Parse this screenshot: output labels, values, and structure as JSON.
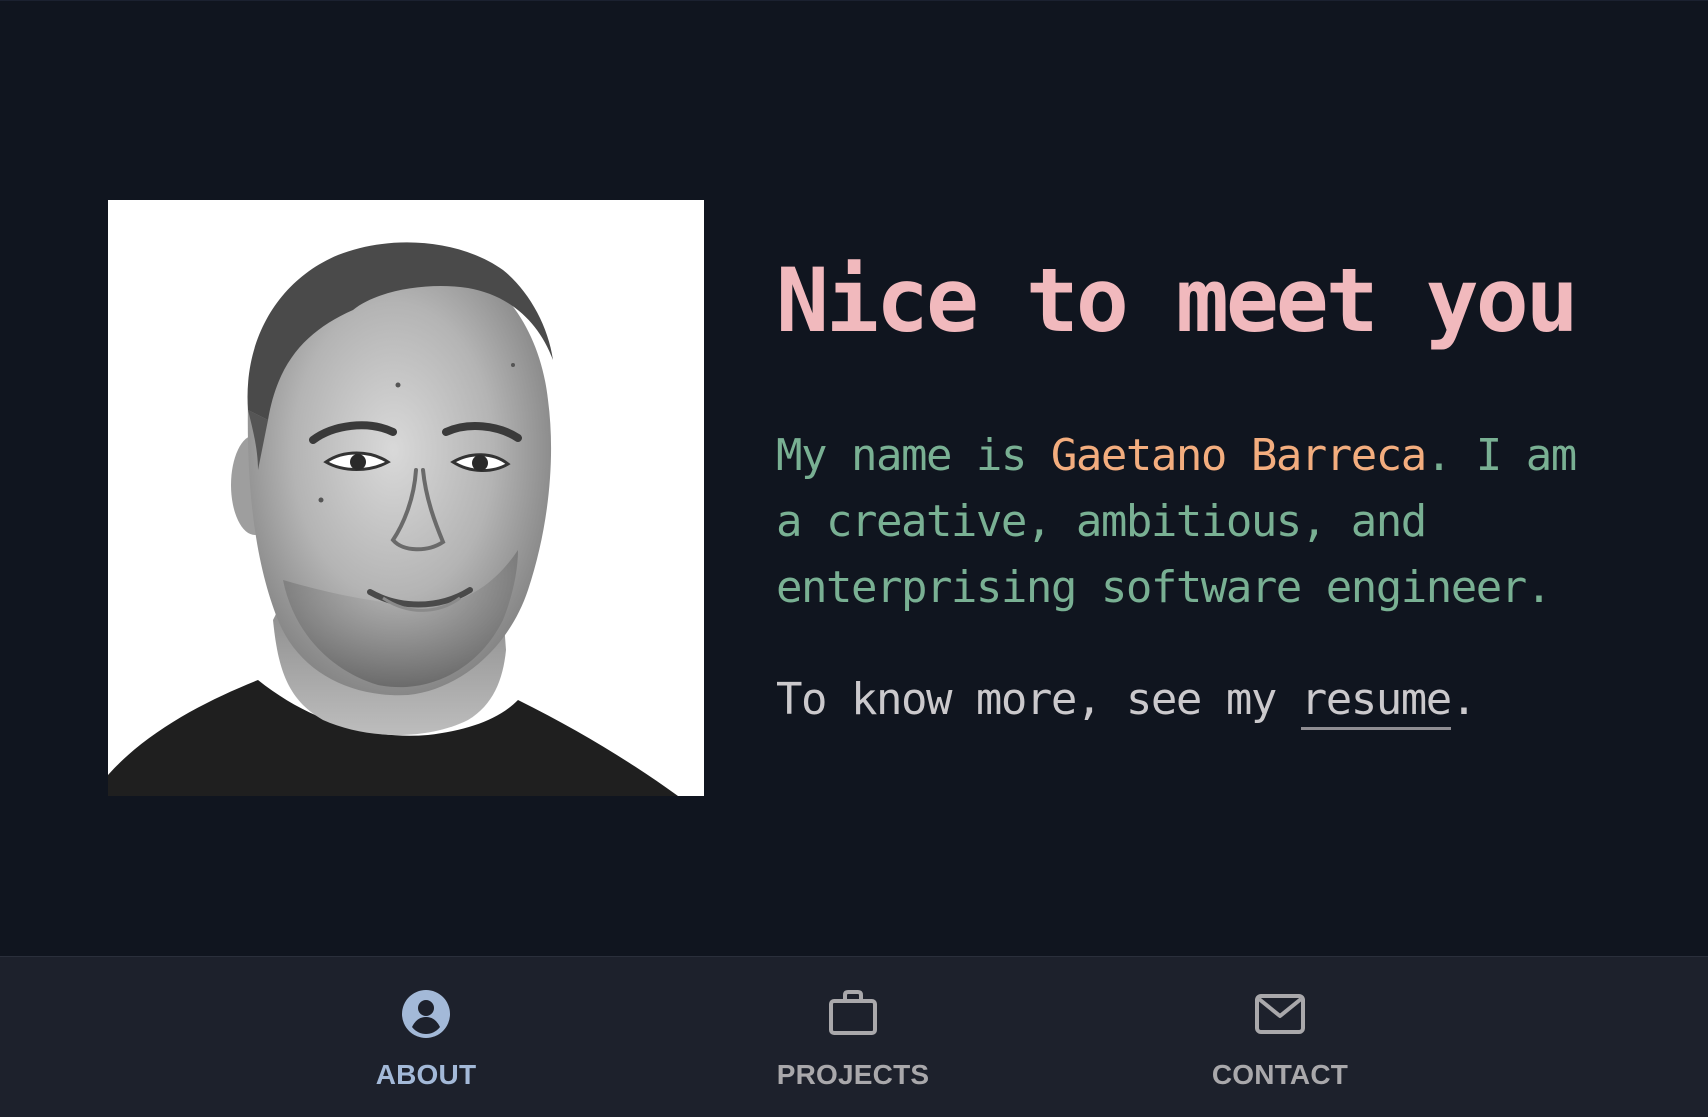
{
  "hero": {
    "headline": "Nice to meet you",
    "intro_prefix": "My name is ",
    "intro_name": "Gaetano Barreca",
    "intro_suffix": ". I am a creative, ambitious, and enterprising software engineer.",
    "more_prefix": "To know more, see my ",
    "more_link": "resume",
    "more_suffix": "."
  },
  "nav": {
    "items": [
      {
        "label": "ABOUT",
        "icon": "account-circle-icon",
        "active": true
      },
      {
        "label": "PROJECTS",
        "icon": "briefcase-icon",
        "active": false
      },
      {
        "label": "CONTACT",
        "icon": "mail-icon",
        "active": false
      }
    ]
  },
  "colors": {
    "background": "#10151f",
    "nav_background": "#1d212c",
    "headline": "#f1b9bd",
    "intro": "#79b093",
    "name_highlight": "#f3ad7e",
    "muted_text": "#cbc9cc",
    "active_nav": "#a3b9d8",
    "inactive_nav": "#a9a8ab"
  }
}
